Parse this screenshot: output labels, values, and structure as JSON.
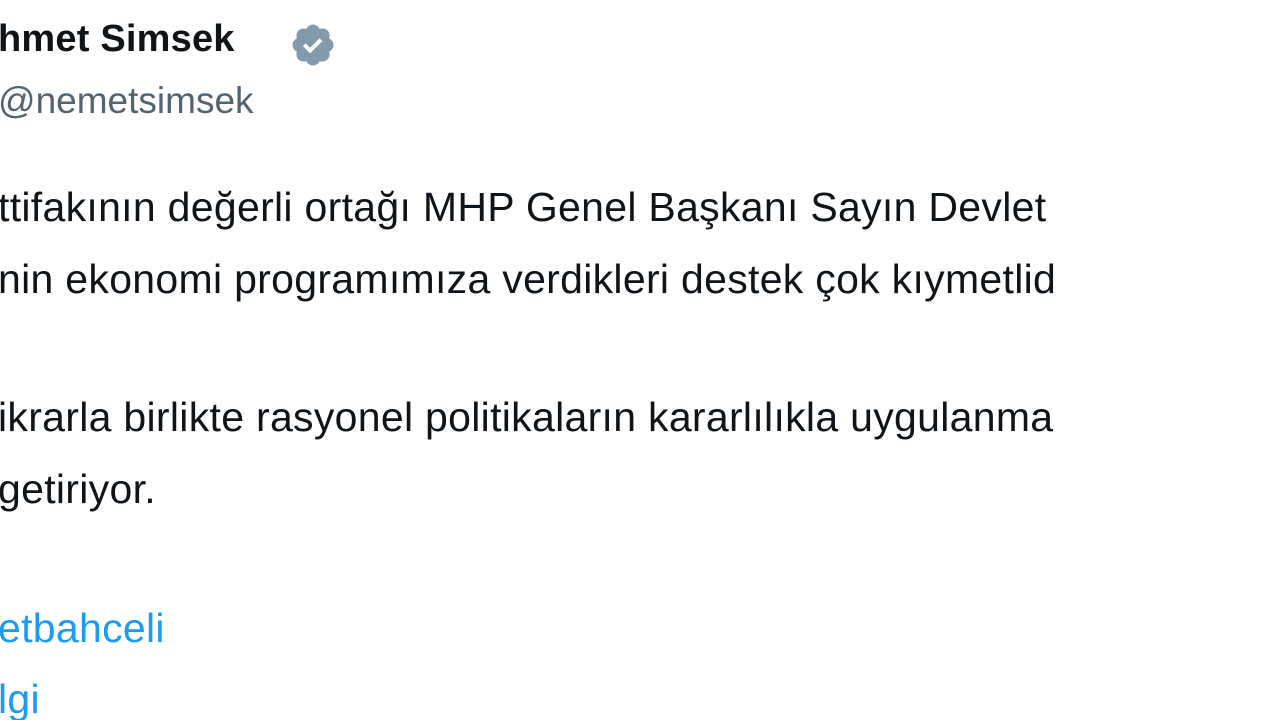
{
  "tweet": {
    "author_name": "hmet Simsek",
    "handle": "nemetsimsek",
    "verified_icon": "verified-badge-icon",
    "lines": [
      "ttifakının değerli ortağı MHP Genel Başkanı Sayın Devlet",
      "nin ekonomi programımıza verdikleri destek çok kıymetlid",
      "ikrarla birlikte rasyonel politikaların kararlılıkla uygulanma",
      "getiriyor."
    ],
    "links": [
      "etbahceli",
      "lgi"
    ]
  },
  "colors": {
    "text": "#0f1419",
    "muted": "#536471",
    "link": "#1d9bf0",
    "badge": "#829aab"
  }
}
